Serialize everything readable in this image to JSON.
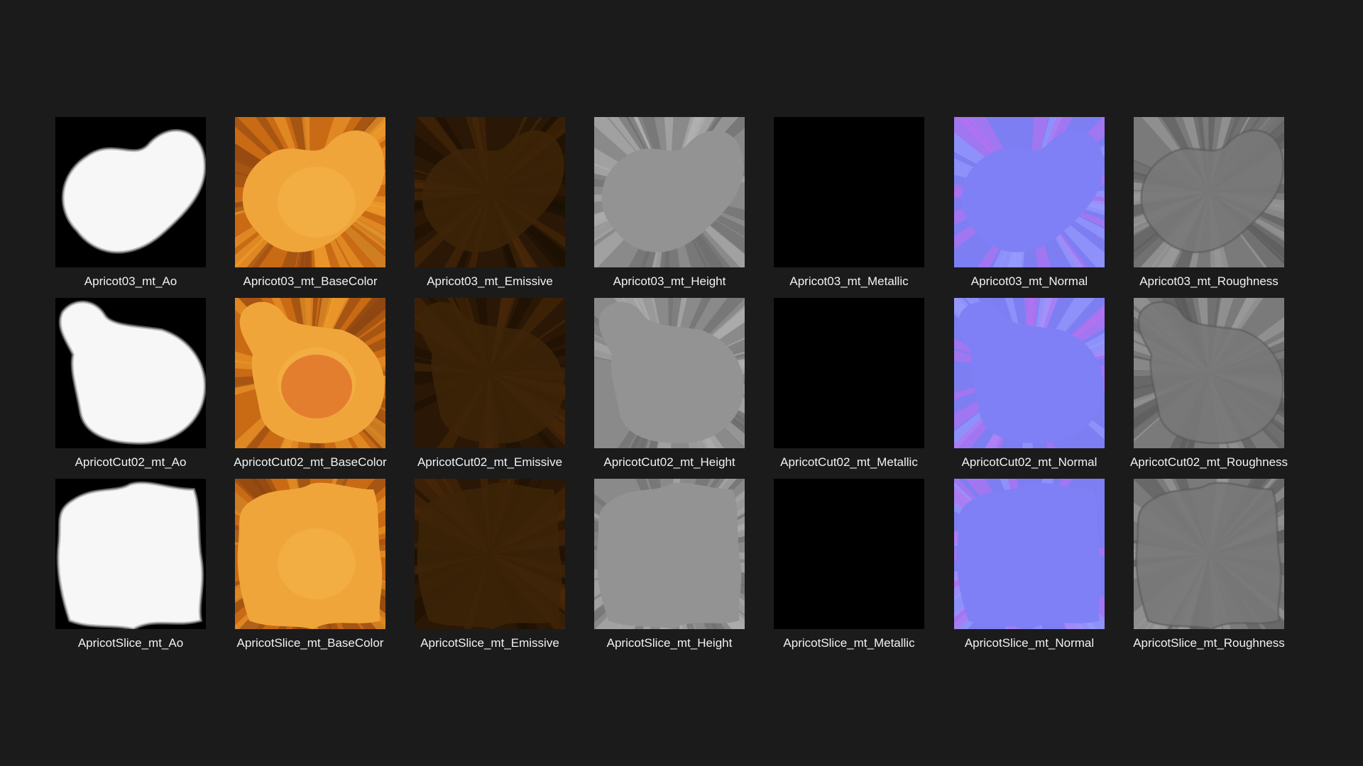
{
  "rows": [
    {
      "tiles": [
        {
          "label": "Apricot03_mt_Ao",
          "kind": "ao",
          "shape": "peanut"
        },
        {
          "label": "Apricot03_mt_BaseColor",
          "kind": "basecolor",
          "shape": "peanut"
        },
        {
          "label": "Apricot03_mt_Emissive",
          "kind": "emissive",
          "shape": "peanut"
        },
        {
          "label": "Apricot03_mt_Height",
          "kind": "height",
          "shape": "peanut"
        },
        {
          "label": "Apricot03_mt_Metallic",
          "kind": "metallic",
          "shape": "peanut"
        },
        {
          "label": "Apricot03_mt_Normal",
          "kind": "normal",
          "shape": "peanut"
        },
        {
          "label": "Apricot03_mt_Roughness",
          "kind": "roughness",
          "shape": "peanut"
        }
      ]
    },
    {
      "tiles": [
        {
          "label": "ApricotCut02_mt_Ao",
          "kind": "ao",
          "shape": "cut"
        },
        {
          "label": "ApricotCut02_mt_BaseColor",
          "kind": "basecolor",
          "shape": "cut"
        },
        {
          "label": "ApricotCut02_mt_Emissive",
          "kind": "emissive",
          "shape": "cut"
        },
        {
          "label": "ApricotCut02_mt_Height",
          "kind": "height",
          "shape": "cut"
        },
        {
          "label": "ApricotCut02_mt_Metallic",
          "kind": "metallic",
          "shape": "cut"
        },
        {
          "label": "ApricotCut02_mt_Normal",
          "kind": "normal",
          "shape": "cut"
        },
        {
          "label": "ApricotCut02_mt_Roughness",
          "kind": "roughness",
          "shape": "cut"
        }
      ]
    },
    {
      "tiles": [
        {
          "label": "ApricotSlice_mt_Ao",
          "kind": "ao",
          "shape": "slice"
        },
        {
          "label": "ApricotSlice_mt_BaseColor",
          "kind": "basecolor",
          "shape": "slice"
        },
        {
          "label": "ApricotSlice_mt_Emissive",
          "kind": "emissive",
          "shape": "slice"
        },
        {
          "label": "ApricotSlice_mt_Height",
          "kind": "height",
          "shape": "slice"
        },
        {
          "label": "ApricotSlice_mt_Metallic",
          "kind": "metallic",
          "shape": "slice"
        },
        {
          "label": "ApricotSlice_mt_Normal",
          "kind": "normal",
          "shape": "slice"
        },
        {
          "label": "ApricotSlice_mt_Roughness",
          "kind": "roughness",
          "shape": "slice"
        }
      ]
    }
  ],
  "colors": {
    "background": "#1b1b1b",
    "label": "#f2f2f2",
    "normal_base": "#7f80f5",
    "basecolor_base": "#e89128",
    "emissive_base": "#3a2208",
    "height_base": "#8e8e8e",
    "roughness_base": "#7b7b7b"
  }
}
